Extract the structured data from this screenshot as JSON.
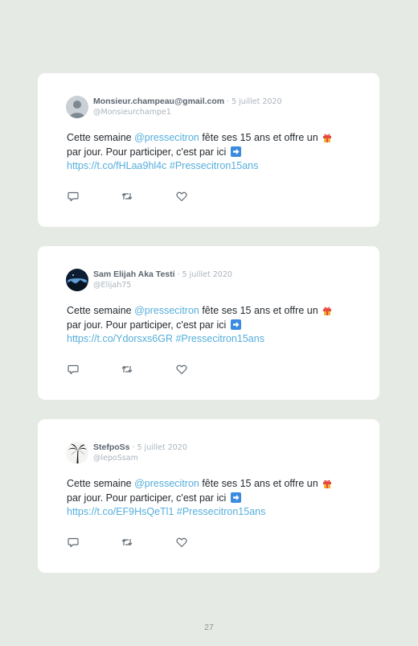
{
  "tweets": [
    {
      "name": "Monsieur.champeau@gmail.com",
      "date": "5 juillet 2020",
      "handle": "@Monsieurchampe1",
      "text_before": "Cette semaine ",
      "mention": "@pressecitron",
      "text_mid": " fête ses 15 ans et offre un ",
      "text_line2": "par jour. Pour participer, c'est par ici ",
      "url": "https://t.co/fHLaa9hl4c",
      "hashtag": "#Pressecitron15ans",
      "avatar": "default-profile-avatar"
    },
    {
      "name": "Sam Elijah Aka Testi",
      "date": "5 juillet 2020",
      "handle": "@Elijah75",
      "text_before": "Cette semaine ",
      "mention": "@pressecitron",
      "text_mid": " fête ses 15 ans et offre un ",
      "text_line2": "par jour. Pour participer, c'est par ici ",
      "url": "https://t.co/Ydorsxs6GR",
      "hashtag": "#Pressecitron15ans",
      "avatar": "night-landscape-avatar"
    },
    {
      "name": "StefpoSs",
      "date": "5 juillet 2020",
      "handle": "@lepoSsam",
      "text_before": "Cette semaine ",
      "mention": "@pressecitron",
      "text_mid": " fête ses 15 ans et offre un ",
      "text_line2": "par jour. Pour participer, c'est par ici ",
      "url": "https://t.co/EF9HsQeTl1",
      "hashtag": "#Pressecitron15ans",
      "avatar": "palm-tree-avatar"
    }
  ],
  "date_separator": "· ",
  "icons": [
    "reply-icon",
    "retweet-icon",
    "like-icon",
    "gift-emoji",
    "right-arrow-emoji"
  ],
  "colors": {
    "background": "#e6eae4",
    "link": "#55aedb",
    "name": "#5a6570",
    "meta": "#aab4bd"
  },
  "page_number": "27"
}
